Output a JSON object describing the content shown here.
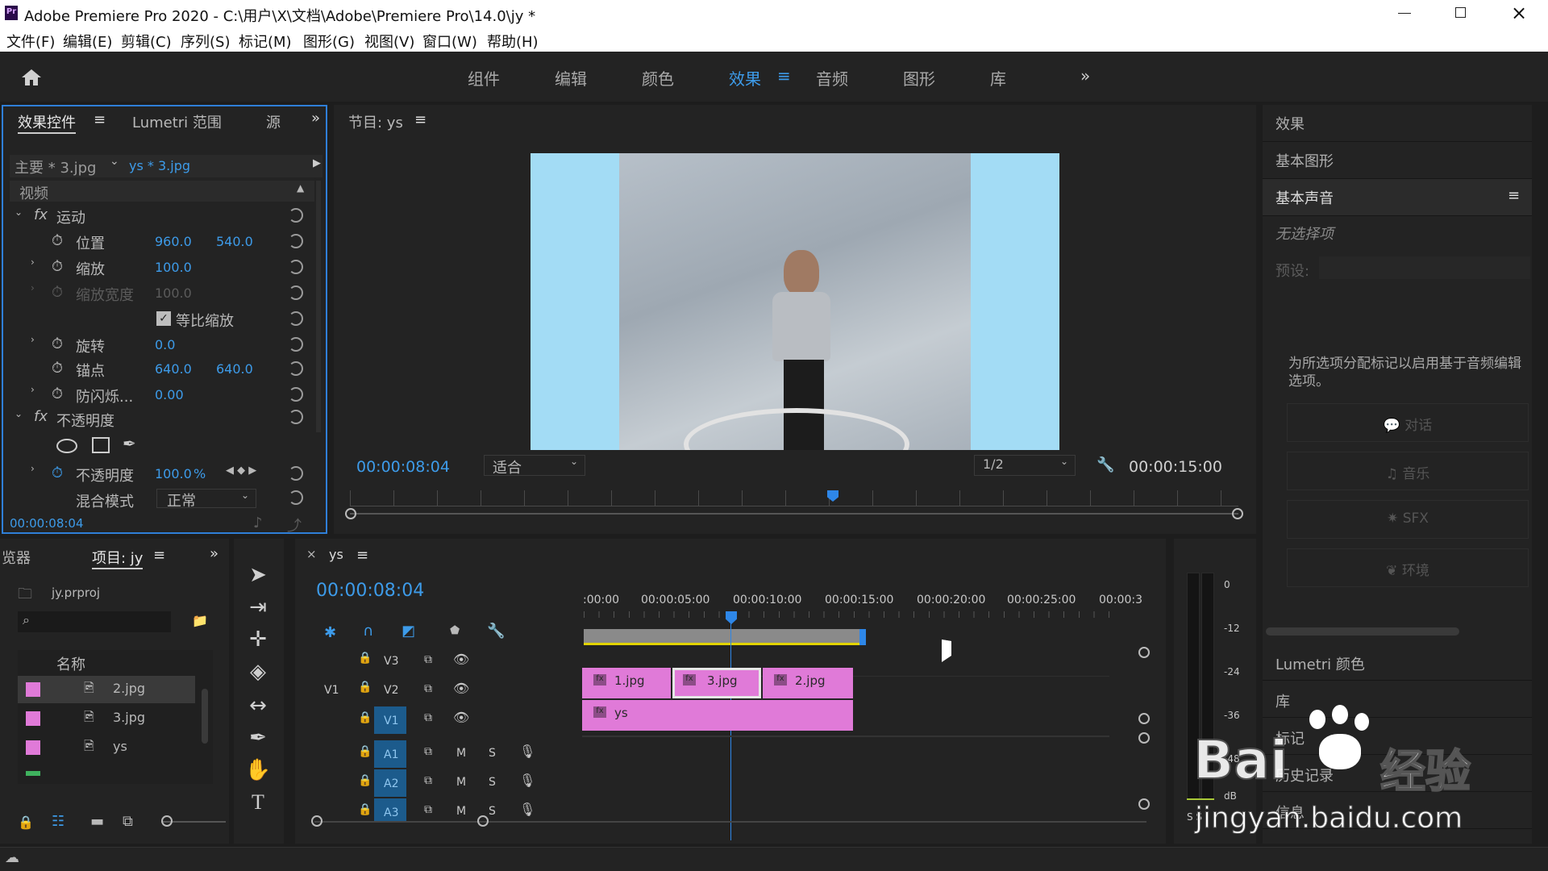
{
  "window": {
    "title": "Adobe Premiere Pro 2020 - C:\\用户\\X\\文档\\Adobe\\Premiere Pro\\14.0\\jy *",
    "app_icon": "Pr"
  },
  "menu": [
    "文件(F)",
    "编辑(E)",
    "剪辑(C)",
    "序列(S)",
    "标记(M)",
    "图形(G)",
    "视图(V)",
    "窗口(W)",
    "帮助(H)"
  ],
  "workspaces": [
    "组件",
    "编辑",
    "颜色",
    "效果",
    "音频",
    "图形",
    "库"
  ],
  "active_workspace": "效果",
  "effect_controls": {
    "tabs": [
      "效果控件",
      "Lumetri 范围",
      "源"
    ],
    "clip_master": "主要 * 3.jpg",
    "clip_seq": "ys * 3.jpg",
    "section_video": "视频",
    "motion": "运动",
    "position_label": "位置",
    "position_x": "960.0",
    "position_y": "540.0",
    "scale_label": "缩放",
    "scale_value": "100.0",
    "scale_width_label": "缩放宽度",
    "scale_width_value": "100.0",
    "uniform_label": "等比缩放",
    "rotation_label": "旋转",
    "rotation_value": "0.0",
    "anchor_label": "锚点",
    "anchor_x": "640.0",
    "anchor_y": "640.0",
    "flicker_label": "防闪烁...",
    "flicker_value": "0.00",
    "opacity_section": "不透明度",
    "opacity_label": "不透明度",
    "opacity_value": "100.0",
    "opacity_unit": "%",
    "blend_label": "混合模式",
    "blend_value": "正常",
    "timecode": "00:00:08:04"
  },
  "program": {
    "title": "节目: ys",
    "timecode": "00:00:08:04",
    "fit": "适合",
    "resolution": "1/2",
    "duration": "00:00:15:00"
  },
  "project": {
    "tabs": [
      "览器",
      "项目: jy"
    ],
    "file": "jy.prproj",
    "name_header": "名称",
    "items": [
      {
        "name": "2.jpg",
        "color": "#e07ad8"
      },
      {
        "name": "3.jpg",
        "color": "#e07ad8"
      },
      {
        "name": "ys",
        "color": "#e07ad8"
      },
      {
        "name": "",
        "color": "#3fb25e"
      }
    ]
  },
  "timeline": {
    "seq": "ys",
    "timecode": "00:00:08:04",
    "ruler": [
      ":00:00",
      "00:00:05:00",
      "00:00:10:00",
      "00:00:15:00",
      "00:00:20:00",
      "00:00:25:00",
      "00:00:3"
    ],
    "video_tracks": [
      "V3",
      "V2",
      "V1"
    ],
    "audio_tracks": [
      "A1",
      "A2",
      "A3"
    ],
    "src_patch": "V1",
    "track_m": "M",
    "track_s": "S",
    "clips_v2": [
      "1.jpg",
      "3.jpg",
      "2.jpg"
    ],
    "clip_v1": "ys"
  },
  "meter": {
    "scale": [
      "0",
      "-12",
      "-24",
      "-36",
      "-48",
      "dB"
    ],
    "bottom": "S S"
  },
  "essential_sound": {
    "panels": [
      "效果",
      "基本图形",
      "基本声音"
    ],
    "no_selection": "无选择项",
    "preset_label": "预设:",
    "help": "为所选项分配标记以启用基于音频编辑选项。",
    "buttons": [
      "对话",
      "音乐",
      "SFX",
      "环境"
    ],
    "bottom_panels": [
      "Lumetri 颜色",
      "库",
      "标记",
      "历史记录",
      "信息"
    ]
  },
  "watermark": {
    "brand": "Bai",
    "brand_cn": "经验",
    "url": "jingyan.baidu.com"
  }
}
